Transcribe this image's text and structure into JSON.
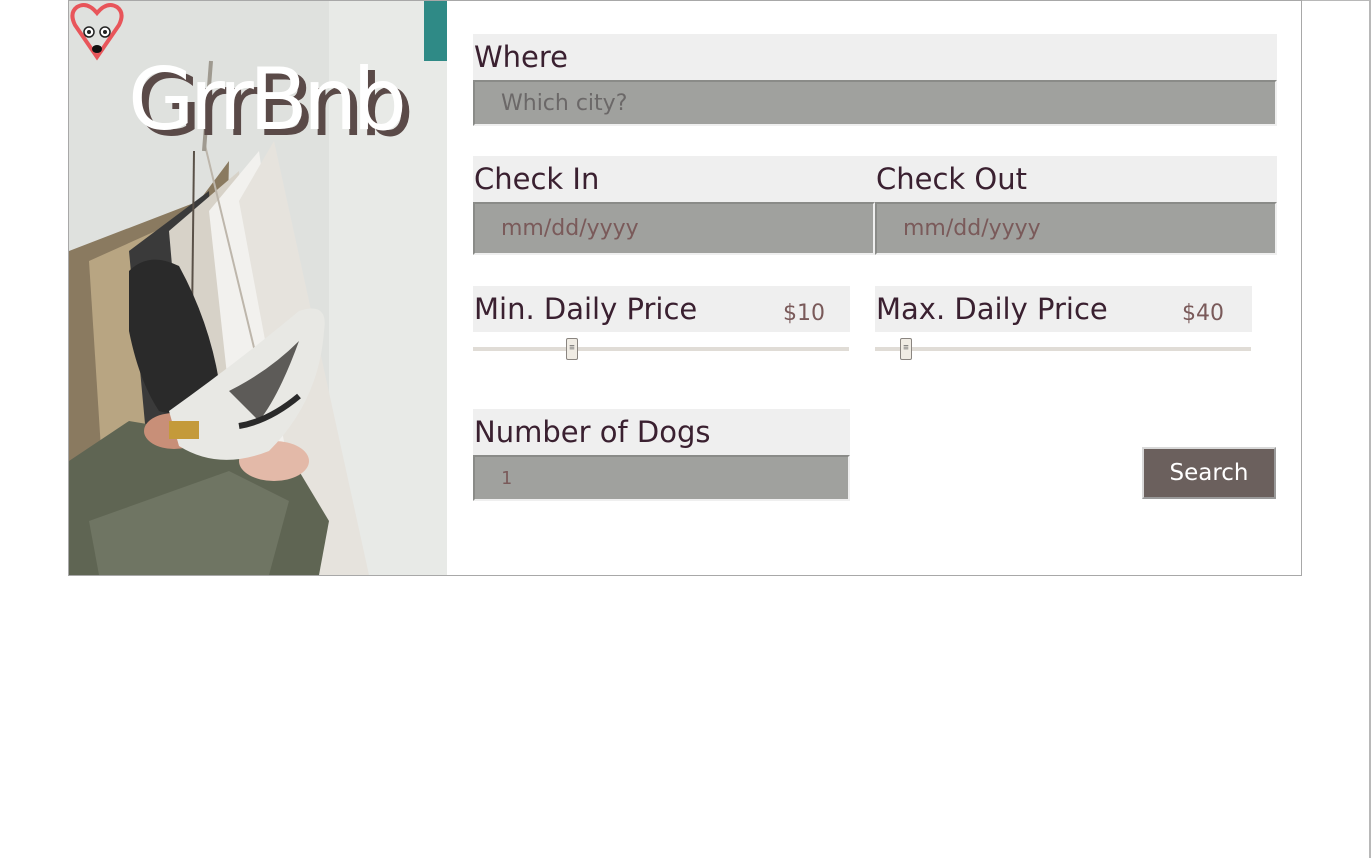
{
  "brand": {
    "name": "GrrBnb",
    "logo_icon": "dog-heart-logo-icon",
    "hero_image": "hammock-sneakers-photo",
    "accent": "#e8555a"
  },
  "form": {
    "where": {
      "label": "Where",
      "placeholder": "Which city?",
      "value": ""
    },
    "check_in": {
      "label": "Check In",
      "placeholder": "mm/dd/yyyy",
      "value": ""
    },
    "check_out": {
      "label": "Check Out",
      "placeholder": "mm/dd/yyyy",
      "value": ""
    },
    "min_price": {
      "label": "Min. Daily Price",
      "display": "$10",
      "value": 10
    },
    "max_price": {
      "label": "Max. Daily Price",
      "display": "$40",
      "value": 40
    },
    "dogs": {
      "label": "Number of Dogs",
      "value": "1"
    },
    "search_label": "Search"
  },
  "colors": {
    "input_bg": "#a0a19e",
    "label_bg": "#efefef",
    "button_bg": "#6b605d"
  }
}
